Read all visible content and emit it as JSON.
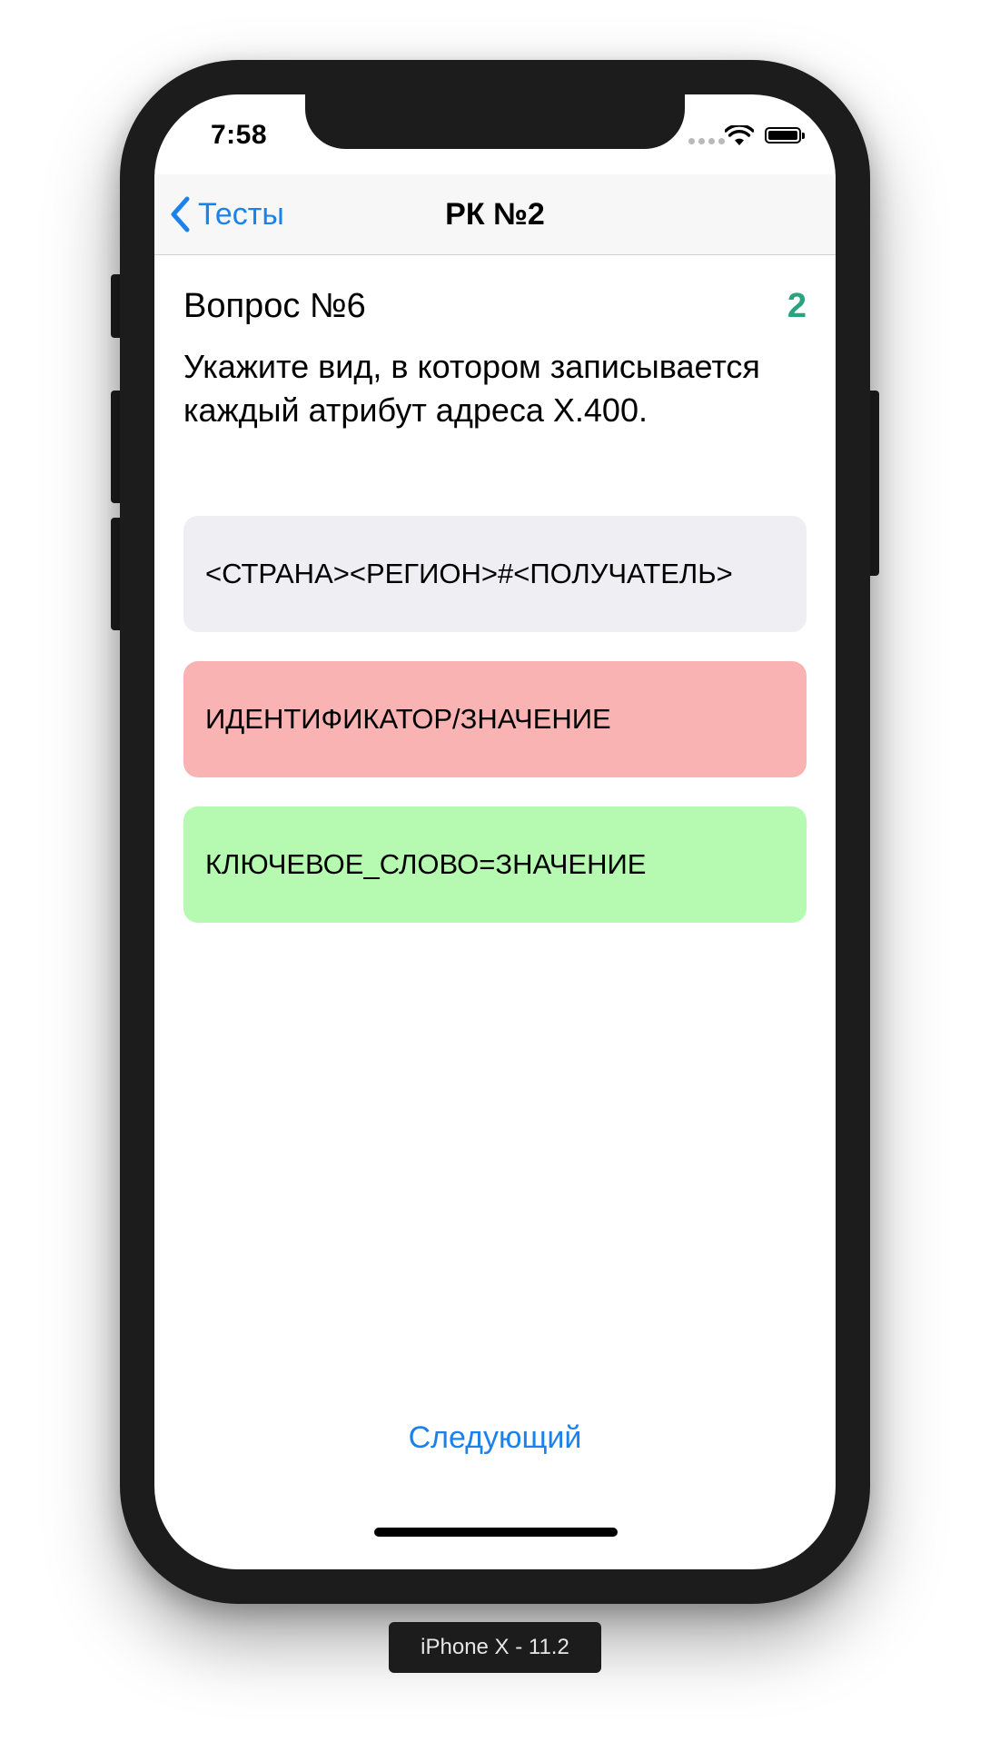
{
  "status_bar": {
    "time": "7:58"
  },
  "nav": {
    "back_label": "Тесты",
    "title": "РК №2"
  },
  "question": {
    "number_label": "Вопрос №6",
    "score": "2",
    "text": "Укажите вид, в котором записывается каждый атрибут адреса X.400."
  },
  "answers": [
    {
      "label": "<СТРАНА><РЕГИОН>#<ПОЛУЧАТЕЛЬ>",
      "state": "neutral",
      "color": "#eeeef3"
    },
    {
      "label": "ИДЕНТИФИКАТОР/ЗНАЧЕНИЕ",
      "state": "wrong",
      "color": "#fab3b3"
    },
    {
      "label": "КЛЮЧЕВОЕ_СЛОВО=ЗНАЧЕНИЕ",
      "state": "correct",
      "color": "#b5fab0"
    }
  ],
  "next_button": {
    "label": "Следующий"
  },
  "device_label": "iPhone X - 11.2",
  "colors": {
    "accent": "#1a82ea",
    "score": "#2aa37e"
  },
  "icons": [
    "chevron-left-icon",
    "wifi-icon",
    "battery-icon",
    "signal-dots-icon"
  ]
}
